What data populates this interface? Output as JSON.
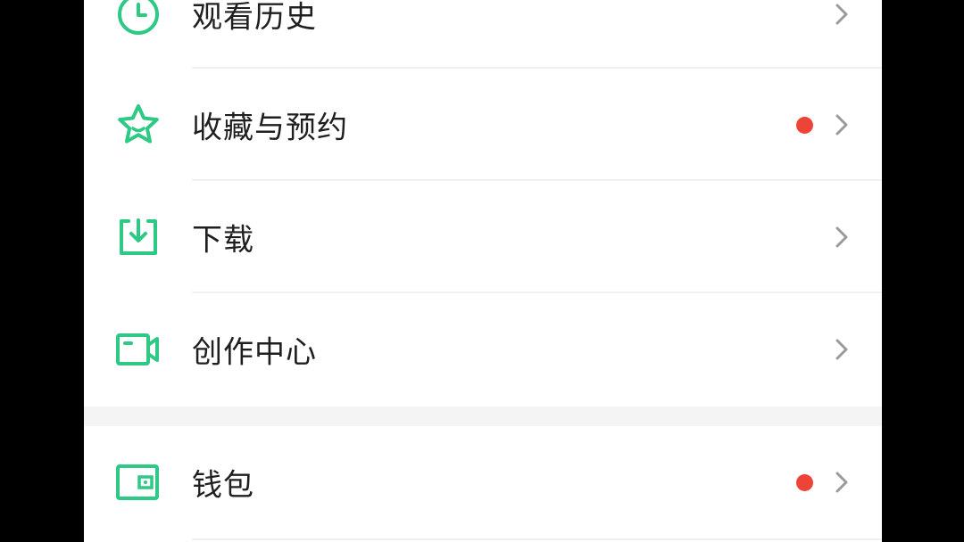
{
  "menu": {
    "items": [
      {
        "label": "观看历史",
        "icon": "clock-icon",
        "badge": false
      },
      {
        "label": "收藏与预约",
        "icon": "star-icon",
        "badge": true
      },
      {
        "label": "下载",
        "icon": "download-icon",
        "badge": false
      },
      {
        "label": "创作中心",
        "icon": "video-camera-icon",
        "badge": false
      },
      {
        "label": "钱包",
        "icon": "wallet-icon",
        "badge": true
      }
    ]
  },
  "colors": {
    "accent": "#2dc985",
    "badge": "#ee4437",
    "text": "#1f1f1f",
    "chevron": "#9a9a9a",
    "background": "#ffffff",
    "section_gap": "#f4f4f5"
  }
}
